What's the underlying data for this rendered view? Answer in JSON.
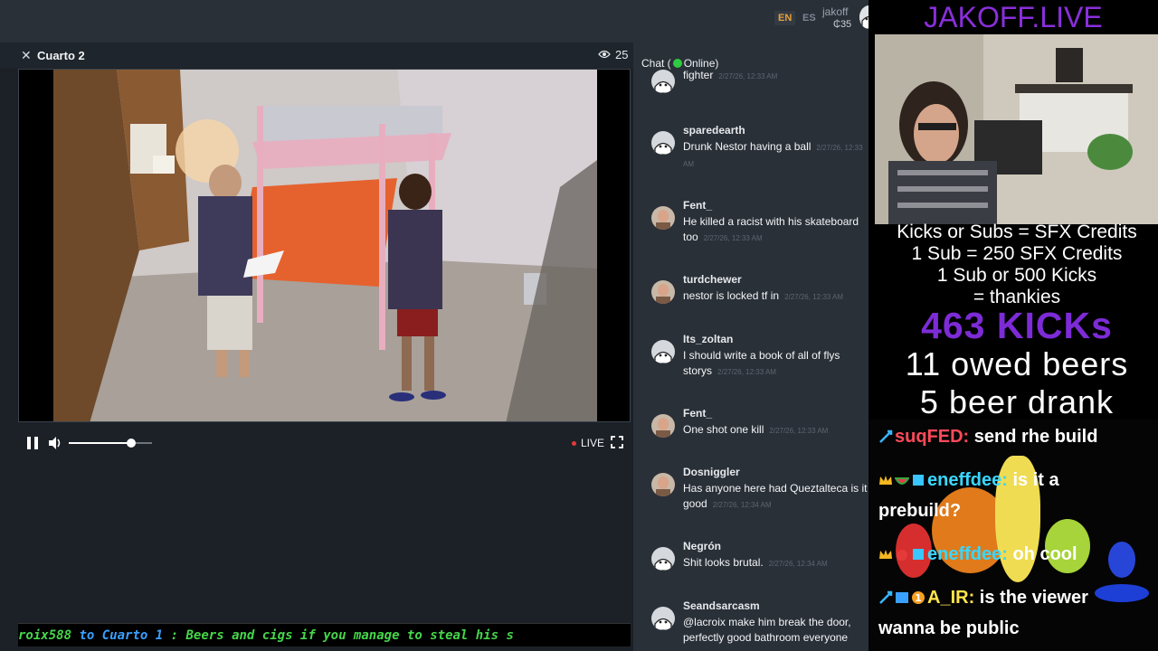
{
  "header": {
    "lang_en": "EN",
    "lang_es": "ES",
    "username": "jakoff",
    "credits": "₵35"
  },
  "player": {
    "room_title": "Cuarto 2",
    "viewer_count": "25",
    "live_label": "LIVE",
    "volume_level": 0.75
  },
  "ticker": {
    "user": "roix588",
    "to": "to",
    "room": "Cuarto 1",
    "separator": ":",
    "message": "Beers and cigs if you manage to steal his s"
  },
  "chat": {
    "header_prefix": "Chat (",
    "header_status": "Online)",
    "messages": [
      {
        "user": "",
        "text": "fighter",
        "time": "2/27/26, 12:33 AM",
        "avatar": "default"
      },
      {
        "user": "sparedearth",
        "text": "Drunk Nestor having a ball",
        "time": "2/27/26, 12:33 AM",
        "avatar": "default"
      },
      {
        "user": "Fent_",
        "text": "He killed a racist with his skateboard too",
        "time": "2/27/26, 12:33 AM",
        "avatar": "photo"
      },
      {
        "user": "turdchewer",
        "text": "nestor is locked tf in",
        "time": "2/27/26, 12:33 AM",
        "avatar": "photo"
      },
      {
        "user": "Its_zoltan",
        "text": "I should write a book of all of flys storys",
        "time": "2/27/26, 12:33 AM",
        "avatar": "default"
      },
      {
        "user": "Fent_",
        "text": "One shot one kill",
        "time": "2/27/26, 12:33 AM",
        "avatar": "photo"
      },
      {
        "user": "Dosniggler",
        "text": "Has anyone here had Queztalteca is it good",
        "time": "2/27/26, 12:34 AM",
        "avatar": "photo"
      },
      {
        "user": "Negrón",
        "text": "Shit looks brutal.",
        "time": "2/27/26, 12:34 AM",
        "avatar": "default"
      },
      {
        "user": "Seandsarcasm",
        "text": "@lacroix make him break the door, perfectly good bathroom everyone",
        "time": "",
        "avatar": "default"
      }
    ]
  },
  "overlay": {
    "brand": "JAKOFF.LIVE",
    "info_lines": [
      "Kicks or Subs = SFX Credits",
      "1 Sub = 250 SFX Credits",
      "1 Sub or 500 Kicks",
      "= thankies"
    ],
    "kicks": "463 KICKs",
    "owed_beers": "11 owed beers",
    "beers_drank": "5 beer drank",
    "chat": [
      {
        "user": "suqFED:",
        "text": " send rhe build"
      },
      {
        "user": "eneffdee:",
        "text": " is it a"
      },
      {
        "user": "",
        "text": "prebuild?"
      },
      {
        "user": "eneffdee:",
        "text": " oh cool"
      },
      {
        "user": "A_IR:",
        "text": " is the viewer"
      },
      {
        "user": "",
        "text": "wanna be public"
      }
    ]
  }
}
